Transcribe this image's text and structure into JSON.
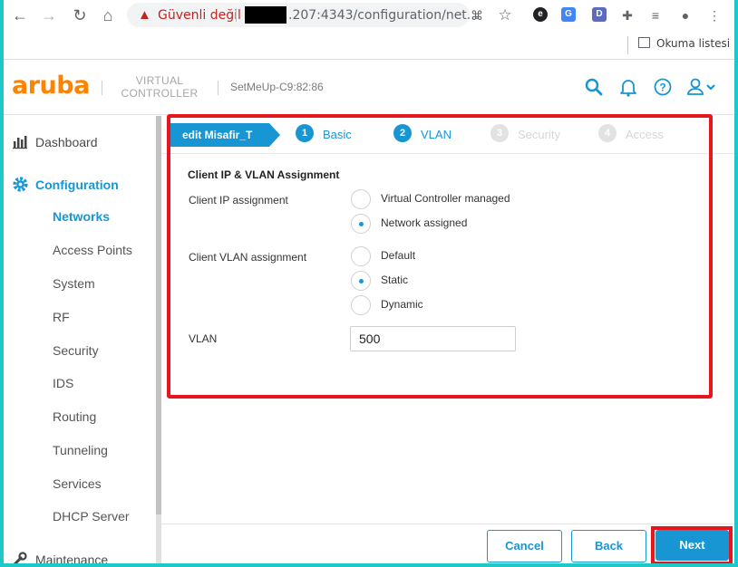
{
  "browser": {
    "security_warning": "Güvenli değil",
    "url_visible": ".207:4343/configuration/net...",
    "reading_list": "Okuma listesi"
  },
  "app": {
    "logo": "aruba",
    "product_line1": "VIRTUAL",
    "product_line2": "CONTROLLER",
    "device": "SetMeUp-C9:82:86"
  },
  "sidebar": {
    "dashboard": "Dashboard",
    "configuration": "Configuration",
    "sub_items": [
      "Networks",
      "Access Points",
      "System",
      "RF",
      "Security",
      "IDS",
      "Routing",
      "Tunneling",
      "Services",
      "DHCP Server"
    ],
    "maintenance": "Maintenance"
  },
  "wizard": {
    "edit_label": "edit Misafir_T",
    "steps": [
      {
        "num": "1",
        "name": "Basic"
      },
      {
        "num": "2",
        "name": "VLAN"
      },
      {
        "num": "3",
        "name": "Security"
      },
      {
        "num": "4",
        "name": "Access"
      }
    ]
  },
  "form": {
    "section_title": "Client IP & VLAN Assignment",
    "ip_label": "Client IP assignment",
    "ip_options": [
      "Virtual Controller managed",
      "Network assigned"
    ],
    "ip_selected": "Network assigned",
    "vlan_assign_label": "Client VLAN assignment",
    "vlan_options": [
      "Default",
      "Static",
      "Dynamic"
    ],
    "vlan_selected": "Static",
    "vlan_label": "VLAN",
    "vlan_value": "500"
  },
  "buttons": {
    "cancel": "Cancel",
    "back": "Back",
    "next": "Next"
  },
  "colors": {
    "accent": "#1896d3",
    "brand": "#ff8300",
    "highlight": "#e8141e"
  }
}
